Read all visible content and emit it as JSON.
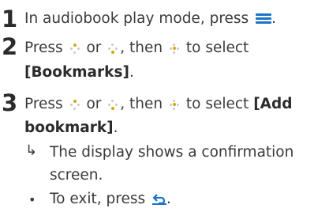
{
  "steps": [
    {
      "number": "1",
      "lines": [
        {
          "before": "In audiobook play mode, press ",
          "icon": "menu-icon",
          "after": "."
        }
      ]
    },
    {
      "number": "2",
      "line1": {
        "t1": "Press ",
        "t2": " or ",
        "t3": ", then ",
        "t4": " to select"
      },
      "line2_bold": "[Bookmarks]",
      "line2_after": "."
    },
    {
      "number": "3",
      "line1": {
        "t1": "Press ",
        "t2": " or ",
        "t3": ", then ",
        "t4": " to select ",
        "bold": "[Add"
      },
      "line2_bold": "bookmark]",
      "line2_after": ".",
      "result_arrow": "↳",
      "result_line1": "The display shows a confirmation",
      "result_line2": "screen.",
      "bullet": "•",
      "bullet_before": "To exit, press ",
      "bullet_after": "."
    }
  ],
  "icons": {
    "menu": "menu-icon",
    "up": "nav-up-icon",
    "down": "nav-down-icon",
    "select": "nav-select-icon",
    "back": "back-icon",
    "accent_color": "#1a73c8",
    "highlight_color": "#d8a800"
  }
}
